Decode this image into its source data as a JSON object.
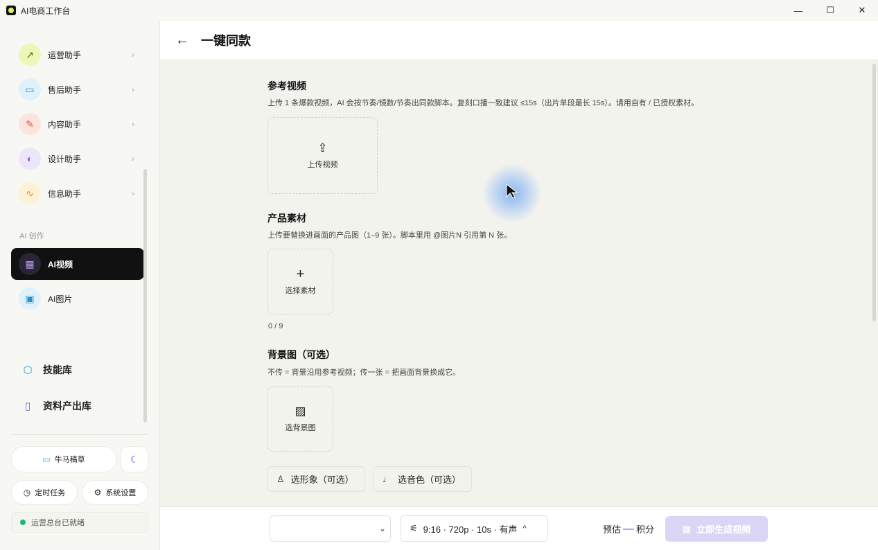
{
  "window": {
    "title": "AI电商工作台",
    "minimize": "—",
    "maximize": "☐",
    "close": "✕"
  },
  "sidebar": {
    "assistants": [
      {
        "label": "运营助手",
        "icon": "trend-icon",
        "color": "#eef7b8",
        "glyph": "↗"
      },
      {
        "label": "售后助手",
        "icon": "chat-icon",
        "color": "#dff1fb",
        "glyph": "▭"
      },
      {
        "label": "内容助手",
        "icon": "pen-icon",
        "color": "#fde4df",
        "glyph": "✎"
      },
      {
        "label": "设计助手",
        "icon": "palette-icon",
        "color": "#ede6fb",
        "glyph": "◐"
      },
      {
        "label": "信息助手",
        "icon": "pulse-icon",
        "color": "#fdf1d6",
        "glyph": "∿"
      }
    ],
    "chevron": "›",
    "section_label": "AI 创作",
    "creation": [
      {
        "label": "AI视频",
        "icon": "film-icon",
        "active": true,
        "glyph": "▦"
      },
      {
        "label": "AI图片",
        "icon": "image-icon",
        "active": false,
        "glyph": "▣"
      }
    ],
    "libraries": [
      {
        "label": "技能库",
        "icon": "cube-icon",
        "glyph": "⬡"
      },
      {
        "label": "资料产出库",
        "icon": "book-icon",
        "glyph": "▯"
      }
    ],
    "draft_button": "牛马稿草",
    "theme_toggle_glyph": "☾",
    "scheduled_tasks": "定时任务",
    "settings": "系统设置",
    "status": "运营总台已就绪"
  },
  "header": {
    "back": "←",
    "title": "一键同款"
  },
  "reference_video": {
    "title": "参考视频",
    "desc": "上传 1 条爆款视频，AI 会按节奏/镜数/节奏出同款脚本。复刻口播一致建议 ≤15s（出片单段最长 15s）。请用自有 / 已授权素材。",
    "upload_label": "上传视频",
    "upload_glyph": "⇪"
  },
  "product_material": {
    "title": "产品素材",
    "desc": "上传要替换进画面的产品图（1–9 张）。脚本里用 @图片N 引用第 N 张。",
    "select_label": "选择素材",
    "select_glyph": "+",
    "count": "0 / 9"
  },
  "background": {
    "title": "背景图（可选）",
    "desc": "不传 = 背景沿用参考视频；传一张 = 把画面背景换成它。",
    "select_label": "选背景图",
    "select_glyph": "▨"
  },
  "options": {
    "avatar": "选形象（可选）",
    "voice": "选音色（可选）"
  },
  "bottom": {
    "select_arrow": "⌄",
    "params": "9:16 · 720p · 10s · 有声",
    "params_caret": "^",
    "estimate_prefix": "预估",
    "estimate_suffix": "积分",
    "generate": "立即生成视频"
  }
}
